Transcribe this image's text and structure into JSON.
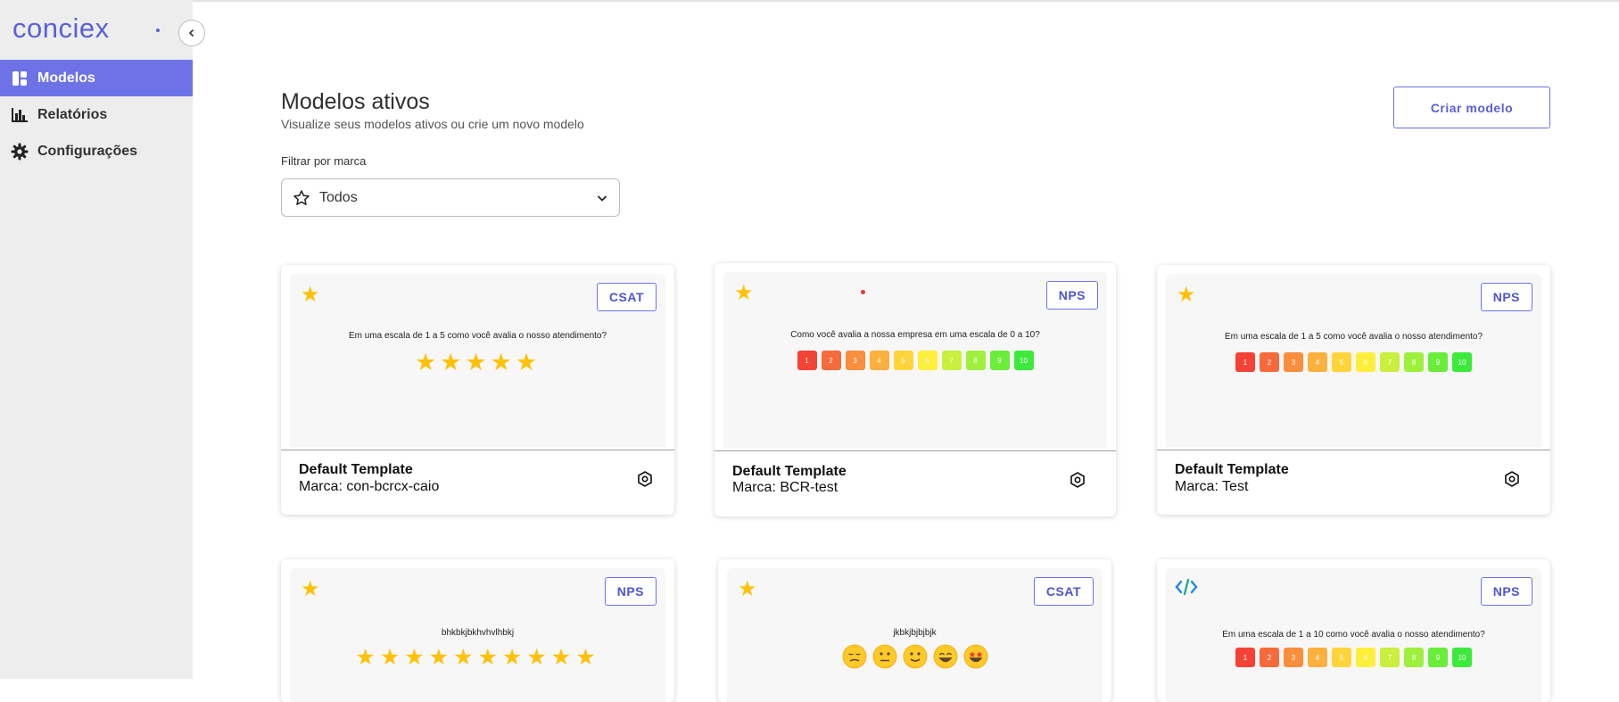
{
  "app": {
    "brand": "conciex"
  },
  "sidebar": {
    "items": [
      {
        "label": "Modelos",
        "icon": "dashboard-icon",
        "active": true
      },
      {
        "label": "Relatórios",
        "icon": "bar-chart-icon",
        "active": false
      },
      {
        "label": "Configurações",
        "icon": "gear-icon",
        "active": false
      }
    ]
  },
  "header": {
    "title": "Modelos ativos",
    "subtitle": "Visualize seus modelos ativos ou crie um novo modelo",
    "create_label": "Criar modelo"
  },
  "filter": {
    "label": "Filtrar por marca",
    "selected": "Todos"
  },
  "nps_colors": [
    "#f44336",
    "#f66a3b",
    "#f98e3c",
    "#fcb03d",
    "#ffd43b",
    "#ffee3a",
    "#c8f03c",
    "#9ef03d",
    "#6bed3c",
    "#3cea3c"
  ],
  "cards": [
    {
      "badge": "CSAT",
      "question": "Em uma escala de 1 a 5 como você avalia o nosso atendimento?",
      "scale": "stars",
      "count": 5,
      "name": "Default Template",
      "brand": "Marca: con-bcrcx-caio",
      "icon": "star-icon"
    },
    {
      "badge": "NPS",
      "question": "Como você avalia a nossa empresa em uma escala de 0 a 10?",
      "scale": "numbers",
      "numbers": [
        "1",
        "2",
        "3",
        "4",
        "5",
        "6",
        "7",
        "8",
        "9",
        "10"
      ],
      "name": "Default Template",
      "brand": "Marca: BCR-test",
      "icon": "star-icon"
    },
    {
      "badge": "NPS",
      "question": "Em uma escala de 1 a 5 como você avalia o nosso atendimento?",
      "scale": "numbers",
      "numbers": [
        "1",
        "2",
        "3",
        "4",
        "5",
        "6",
        "7",
        "8",
        "9",
        "10"
      ],
      "name": "Default Template",
      "brand": "Marca: Test",
      "icon": "star-icon"
    },
    {
      "badge": "NPS",
      "question": "bhkbkjbkhvhvlhbkj",
      "scale": "stars",
      "count": 10,
      "icon": "star-icon"
    },
    {
      "badge": "CSAT",
      "question": "jkbkjbjbjbjk",
      "scale": "emojis",
      "emojis": [
        "😔",
        "😐",
        "🙂",
        "😄",
        "🤩"
      ],
      "icon": "star-icon"
    },
    {
      "badge": "NPS",
      "question": "Em uma escala de 1 a 10 como você avalia o nosso atendimento?",
      "scale": "numbers",
      "numbers": [
        "1",
        "2",
        "3",
        "4",
        "5",
        "6",
        "7",
        "8",
        "9",
        "10"
      ],
      "icon": "code-icon"
    }
  ]
}
